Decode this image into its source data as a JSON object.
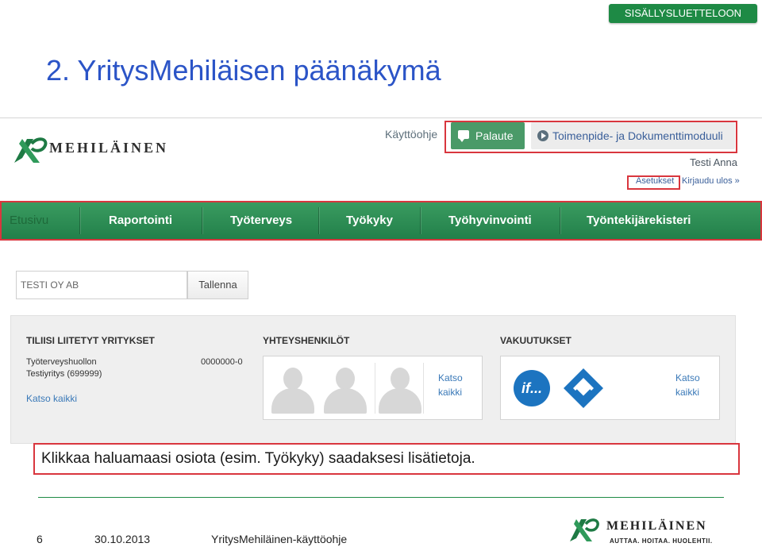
{
  "toc_button": "SISÄLLYSLUETTELOON",
  "page_title": "2. YritysMehiläisen päänäkymä",
  "app": {
    "logo_text": "MEHILÄINEN",
    "help_link": "Käyttöohje",
    "feedback_button": "Palaute",
    "module_button": "Toimenpide- ja Dokumenttimoduuli",
    "user_name": "Testi Anna",
    "settings_link": "Asetukset",
    "logout_link": "Kirjaudu ulos »",
    "nav": [
      "Etusivu",
      "Raportointi",
      "Työterveys",
      "Työkyky",
      "Työhyvinvointi",
      "Työntekijärekisteri"
    ],
    "company_input_value": "TESTI OY AB",
    "save_button": "Tallenna",
    "companies": {
      "title": "TILIISI LIITETYT YRITYKSET",
      "row1_name": "Työterveyshuollon",
      "row1_id": "0000000-0",
      "row2_name": "Testiyritys (699999)",
      "see_all": "Katso kaikki"
    },
    "contacts": {
      "title": "YHTEYSHENKILÖT",
      "see_line1": "Katso",
      "see_line2": "kaikki"
    },
    "insurances": {
      "title": "VAKUUTUKSET",
      "if_logo": "if...",
      "see_line1": "Katso",
      "see_line2": "kaikki"
    }
  },
  "caption": "Klikkaa haluamaasi osiota (esim. Työkyky) saadaksesi lisätietoja.",
  "footer": {
    "page_number": "6",
    "date": "30.10.2013",
    "guide_name": "YritysMehiläinen-käyttöohje",
    "logo_text": "MEHILÄINEN",
    "tagline": "AUTTAA. HOITAA. HUOLEHTII."
  },
  "colors": {
    "brand_green": "#1e8a45",
    "title_blue": "#2b54c7",
    "highlight_red": "#d9363e",
    "link_blue": "#3a79b8"
  }
}
